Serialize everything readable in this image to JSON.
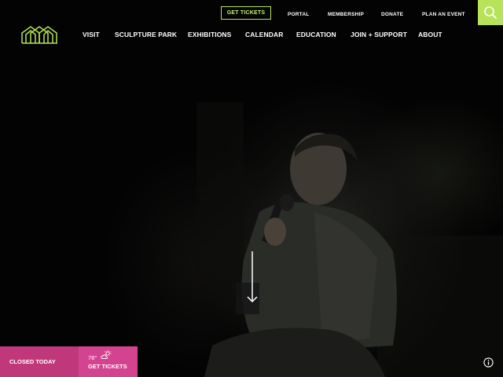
{
  "utility_nav": {
    "get_tickets": "GET TICKETS",
    "links": [
      "PORTAL",
      "MEMBERSHIP",
      "DONATE",
      "PLAN AN EVENT"
    ]
  },
  "main_nav": {
    "items": [
      "VISIT",
      "SCULPTURE PARK",
      "EXHIBITIONS",
      "CALENDAR",
      "EDUCATION",
      "JOIN + SUPPORT",
      "ABOUT"
    ]
  },
  "status_bar": {
    "status": "CLOSED TODAY",
    "temperature": "78°",
    "tickets": "GET TICKETS"
  },
  "icons": {
    "search": "search-icon",
    "logo": "house-outline-logo",
    "scroll": "arrow-down-icon",
    "weather": "partly-cloudy-icon",
    "info": "info-icon"
  },
  "colors": {
    "accent": "#b7e35a",
    "status_pink": "#c0387a",
    "tickets_pink": "#d4438f",
    "background": "#030303"
  }
}
